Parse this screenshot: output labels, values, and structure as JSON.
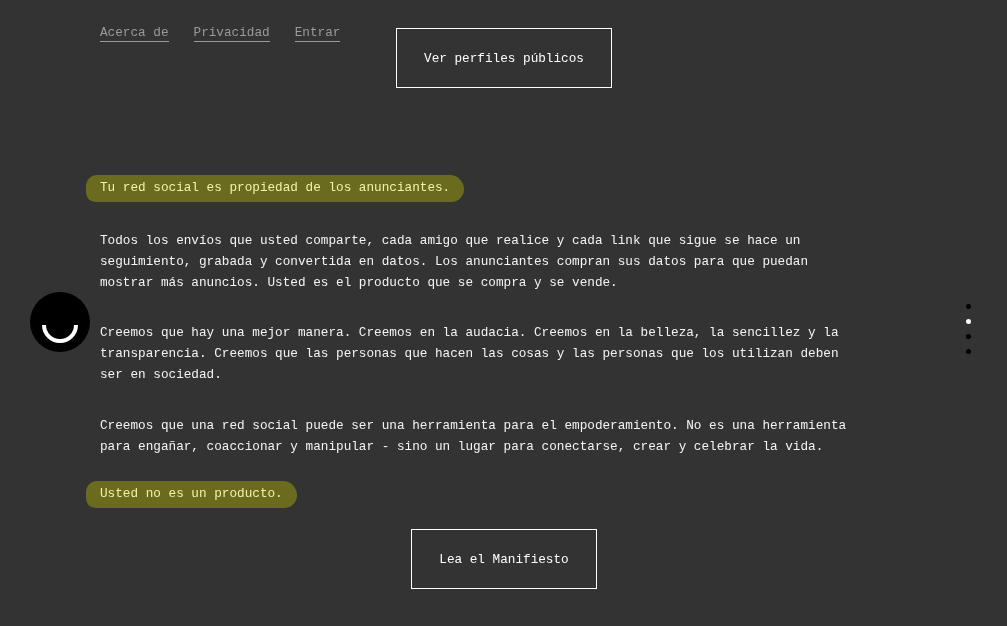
{
  "nav": {
    "links": [
      "Acerca de",
      "Privacidad",
      "Entrar"
    ],
    "button": "Ver perfiles públicos"
  },
  "content": [
    {
      "kind": "highlight",
      "text": "Tu red social es propiedad de los anunciantes."
    },
    {
      "kind": "paragraph",
      "text": "Todos los envíos que usted comparte, cada amigo que realice y cada link que sigue se hace un seguimiento, grabada y convertida en datos. Los anunciantes compran sus datos para que puedan mostrar más anuncios. Usted es el producto que se compra y se vende."
    },
    {
      "kind": "paragraph",
      "text": "Creemos que hay una mejor manera. Creemos en la audacia. Creemos en la belleza, la sencillez y la transparencia. Creemos que las personas que hacen las cosas y las personas que los utilizan deben ser en sociedad."
    },
    {
      "kind": "paragraph",
      "text": "Creemos que una red social puede ser una herramienta para el empoderamiento. No es una herramienta para engañar, coaccionar y manipular - sino un lugar para conectarse, crear y celebrar la vida."
    },
    {
      "kind": "highlight",
      "text": "Usted no es un producto."
    }
  ],
  "cta": "Lea el Manifiesto",
  "page_dots": [
    {
      "selected": false
    },
    {
      "selected": true
    },
    {
      "selected": false
    },
    {
      "selected": false
    }
  ]
}
